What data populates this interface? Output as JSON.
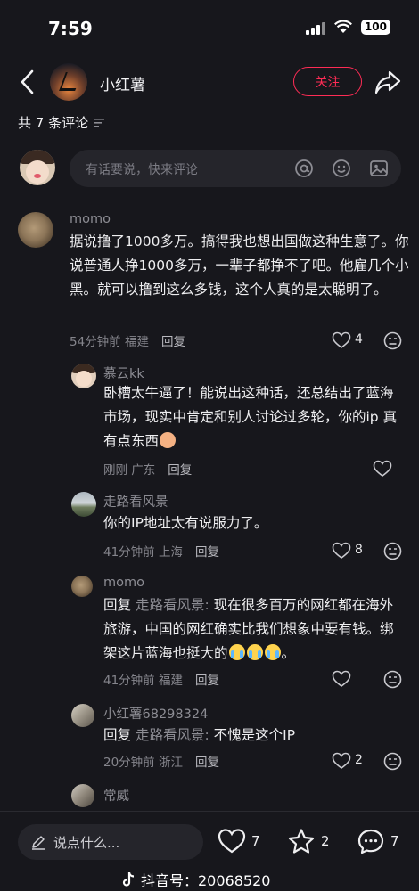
{
  "status_bar": {
    "time": "7:59",
    "battery": "100"
  },
  "header": {
    "back_icon": "chevron-left-icon",
    "author_name": "小红薯",
    "follow_label": "关注",
    "share_icon": "share-arrow-icon"
  },
  "comment_count": "共 7 条评论",
  "composer": {
    "placeholder": "有话要说，快来评论"
  },
  "comments": [
    {
      "name": "momo",
      "text": "据说撸了1000多万。搞得我也想出国做这种生意了。你说普通人挣1000多万，一辈子都挣不了吧。他雇几个小黑。就可以撸到这么多钱，这个人真的是太聪明了。",
      "meta": "54分钟前 福建",
      "reply_label": "回复",
      "likes": "4"
    },
    {
      "name": "慕云kk",
      "text": "卧槽太牛逼了！能说出这种话，还总结出了蓝海市场，现实中肯定和别人讨论过多轮，你的ip 真有点东西",
      "meta": "刚刚 广东",
      "reply_label": "回复",
      "likes": ""
    },
    {
      "name": "走路看风景",
      "text": "你的IP地址太有说服力了。",
      "meta": "41分钟前 上海",
      "reply_label": "回复",
      "likes": "8"
    },
    {
      "name": "momo",
      "reply_prefix": "回复",
      "reply_to": "走路看风景:",
      "text": "现在很多百万的网红都在海外旅游，中国的网红确实比我们想象中要有钱。绑架这片蓝海也挺大的",
      "meta": "41分钟前 福建",
      "reply_label": "回复",
      "likes": ""
    },
    {
      "name": "小红薯68298324",
      "reply_prefix": "回复",
      "reply_to": "走路看风景:",
      "text": "不愧是这个IP",
      "meta": "20分钟前 浙江",
      "reply_label": "回复",
      "likes": "2"
    },
    {
      "name": "常威"
    }
  ],
  "bottom_bar": {
    "input_placeholder": "说点什么...",
    "likes": "7",
    "collects": "2",
    "comments": "7"
  },
  "watermark": "抖音号：20068520"
}
